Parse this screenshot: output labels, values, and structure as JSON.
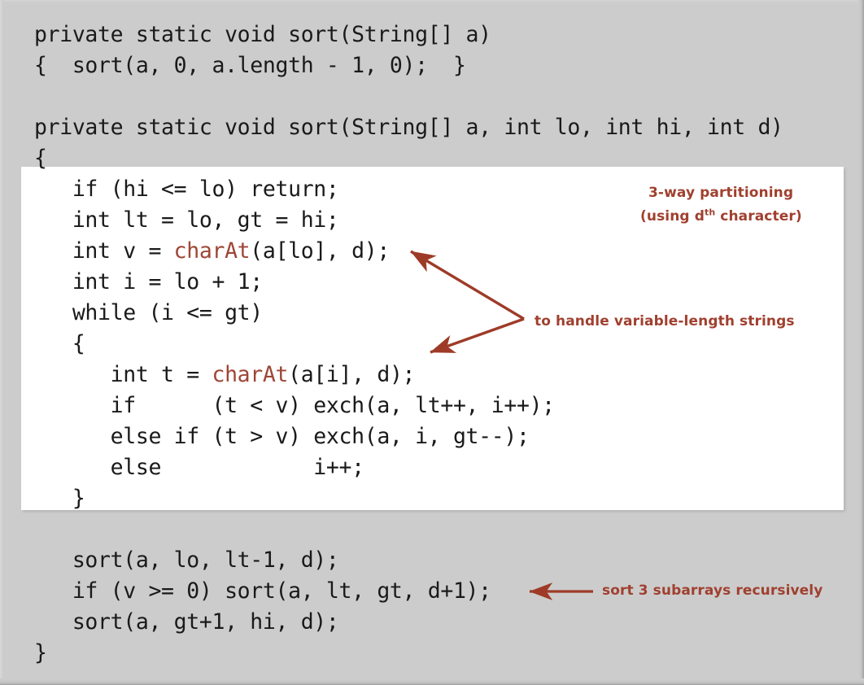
{
  "slide": {
    "background_color": "#cccccc",
    "highlight_panel_color": "#ffffff",
    "code_color": "#1a1a1a",
    "accent_color": "#a0402f",
    "keyword_color": "#9e4636"
  },
  "code": {
    "top_block": [
      "private static void sort(String[] a)",
      "{  sort(a, 0, a.length - 1, 0);  }",
      "",
      "private static void sort(String[] a, int lo, int hi, int d)",
      "{"
    ],
    "highlighted_block": {
      "line1": "   if (hi <= lo) return;",
      "line2": "   int lt = lo, gt = hi;",
      "line3_before": "   int v = ",
      "line3_keyword": "charAt",
      "line3_after": "(a[lo], d);",
      "line4": "   int i = lo + 1;",
      "line5": "   while (i <= gt)",
      "line6": "   {",
      "line7_before": "      int t = ",
      "line7_keyword": "charAt",
      "line7_after": "(a[i], d);",
      "line8": "      if      (t < v) exch(a, lt++, i++);",
      "line9": "      else if (t > v) exch(a, i, gt--);",
      "line10": "      else            i++;",
      "line11": "   }"
    },
    "bottom_block": [
      "   sort(a, lo, lt-1, d);",
      "   if (v >= 0) sort(a, lt, gt, d+1);",
      "   sort(a, gt+1, hi, d);",
      "}"
    ]
  },
  "annotations": {
    "three_way_line1": "3-way partitioning",
    "three_way_line2_pre": "(using d",
    "three_way_line2_sup": "th",
    "three_way_line2_post": " character)",
    "variable_length": "to handle variable-length strings",
    "recursive": "sort 3 subarrays recursively"
  },
  "arrows": {
    "double_arrow_name": "double-headed-arrow-to-charat-calls",
    "left_arrow_name": "left-arrow-to-recursive-sorts",
    "color": "#9e3b28"
  }
}
